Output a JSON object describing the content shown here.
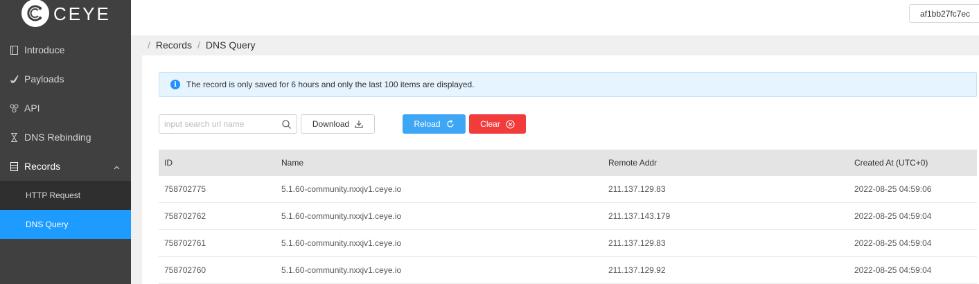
{
  "app": {
    "logo_text": "CEYE"
  },
  "sidebar": {
    "items": [
      {
        "label": "Introduce"
      },
      {
        "label": "Payloads"
      },
      {
        "label": "API"
      },
      {
        "label": "DNS Rebinding"
      },
      {
        "label": "Records"
      }
    ],
    "sub_items": [
      {
        "label": "HTTP Request"
      },
      {
        "label": "DNS Query"
      }
    ]
  },
  "header": {
    "user_identifier": "af1bb27fc7ec"
  },
  "breadcrumb": {
    "items": [
      "Records",
      "DNS Query"
    ]
  },
  "alert": {
    "text": "The record is only saved for 6 hours and only the last 100 items are displayed."
  },
  "toolbar": {
    "search_placeholder": "input search url name",
    "download_label": "Download",
    "reload_label": "Reload",
    "clear_label": "Clear"
  },
  "table": {
    "headers": [
      "ID",
      "Name",
      "Remote Addr",
      "Created At (UTC+0)"
    ],
    "rows": [
      [
        "758702775",
        "5.1.60-community.nxxjv1.ceye.io",
        "211.137.129.83",
        "2022-08-25 04:59:06"
      ],
      [
        "758702762",
        "5.1.60-community.nxxjv1.ceye.io",
        "211.137.143.179",
        "2022-08-25 04:59:04"
      ],
      [
        "758702761",
        "5.1.60-community.nxxjv1.ceye.io",
        "211.137.129.83",
        "2022-08-25 04:59:04"
      ],
      [
        "758702760",
        "5.1.60-community.nxxjv1.ceye.io",
        "211.137.129.92",
        "2022-08-25 04:59:04"
      ]
    ]
  },
  "colors": {
    "sidebar_bg": "#404040",
    "active_menu": "#1e9bff",
    "reload": "#3ea7f5",
    "clear": "#f23b3b"
  }
}
